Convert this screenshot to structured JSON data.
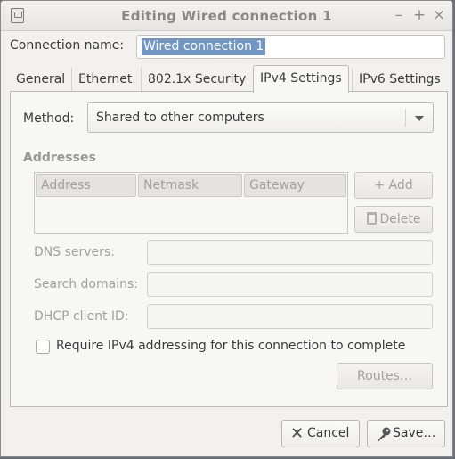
{
  "window": {
    "title": "Editing Wired connection 1",
    "controls": {
      "minimize": "–",
      "maximize": "+",
      "close": "×"
    }
  },
  "connection": {
    "label": "Connection name:",
    "value": "Wired connection 1"
  },
  "tabs": [
    {
      "label": "General"
    },
    {
      "label": "Ethernet"
    },
    {
      "label": "802.1x Security"
    },
    {
      "label": "IPv4 Settings",
      "active": true
    },
    {
      "label": "IPv6 Settings"
    }
  ],
  "ipv4": {
    "method_label": "Method:",
    "method_value": "Shared to other computers",
    "addresses_heading": "Addresses",
    "columns": [
      "Address",
      "Netmask",
      "Gateway"
    ],
    "add_label": "+ Add",
    "delete_label": "Delete",
    "dns_label": "DNS servers:",
    "search_label": "Search domains:",
    "dhcp_label": "DHCP client ID:",
    "require_label": "Require IPv4 addressing for this connection to complete",
    "require_checked": false,
    "routes_label": "Routes…"
  },
  "buttons": {
    "cancel": "Cancel",
    "save": "Save…"
  },
  "colors": {
    "selection": "#7296c4",
    "window_bg": "#f2f1f0",
    "disabled_text": "#a3a19d"
  }
}
